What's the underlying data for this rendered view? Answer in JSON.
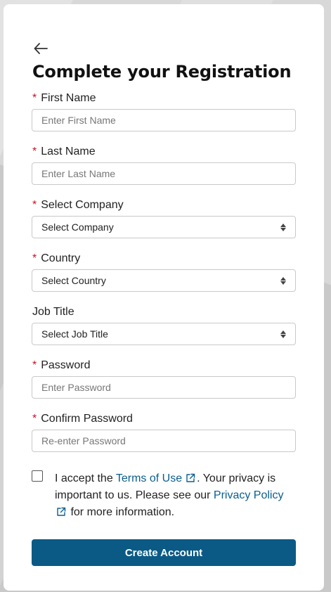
{
  "title": "Complete your Registration",
  "required_marker": "*",
  "fields": {
    "first_name": {
      "label": "First Name",
      "placeholder": "Enter First Name",
      "required": true
    },
    "last_name": {
      "label": "Last Name",
      "placeholder": "Enter Last Name",
      "required": true
    },
    "company": {
      "label": "Select Company",
      "value": "Select Company",
      "required": true
    },
    "country": {
      "label": "Country",
      "value": "Select Country",
      "required": true
    },
    "job_title": {
      "label": "Job Title",
      "value": "Select Job Title",
      "required": false
    },
    "password": {
      "label": "Password",
      "placeholder": "Enter Password",
      "required": true
    },
    "confirm_password": {
      "label": "Confirm Password",
      "placeholder": "Re-enter Password",
      "required": true
    }
  },
  "consent": {
    "checked": false,
    "text_before": "I accept the ",
    "terms_link": "Terms of Use",
    "text_middle": ". Your privacy is important to us. Please see our ",
    "privacy_link": "Privacy Policy",
    "text_after": " for more information."
  },
  "submit_label": "Create Account",
  "colors": {
    "accent": "#0b5a85",
    "link": "#0a5e8f",
    "required": "#c8102e"
  },
  "icons": {
    "back": "arrow-left-icon",
    "select": "sort-arrows-icon",
    "external": "external-link-icon"
  }
}
